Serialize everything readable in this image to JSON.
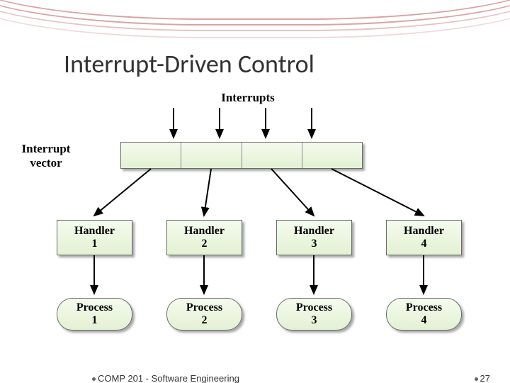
{
  "title": "Interrupt-Driven Control",
  "labels": {
    "interrupts": "Interrupts",
    "vector": "Interrupt\nvector"
  },
  "handlers": [
    "Handler\n1",
    "Handler\n2",
    "Handler\n3",
    "Handler\n4"
  ],
  "processes": [
    "Process\n1",
    "Process\n2",
    "Process\n3",
    "Process\n4"
  ],
  "footer": {
    "left": "COMP 201 - Software Engineering",
    "right": "27"
  }
}
